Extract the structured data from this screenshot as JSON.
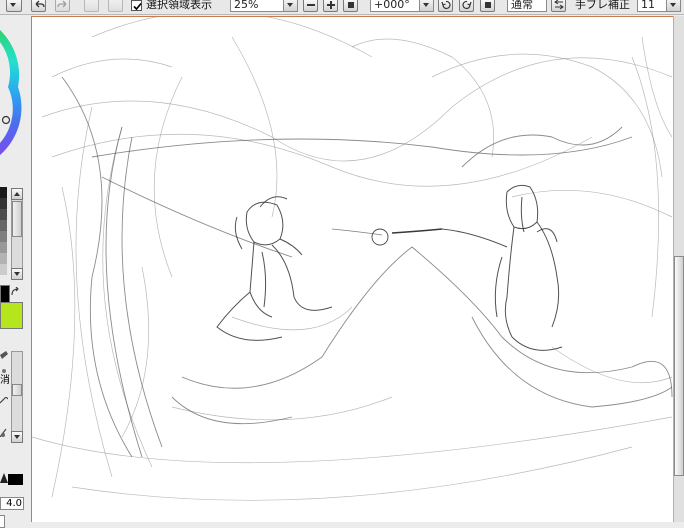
{
  "toolbar": {
    "undo_icon": "undo-icon",
    "redo_icon": "redo-icon",
    "selection_checked": true,
    "selection_label": "選択領域表示",
    "zoom_value": "25%",
    "zoom_buttons": [
      "zoom-out-icon",
      "zoom-in-icon",
      "zoom-reset-icon"
    ],
    "rotation_value": "+000°",
    "rotation_buttons": [
      "rotate-left-icon",
      "rotate-right-icon",
      "rotate-reset-icon"
    ],
    "blend_mode": "通常",
    "flip_icon": "flip-horizontal-icon",
    "stabilizer_label": "手ブレ補正",
    "stabilizer_value": "11"
  },
  "left_panel": {
    "color_wheel_icon": "color-wheel",
    "primary_color": "#000000",
    "secondary_color": "#b5e61d",
    "swap_icon": "swap-colors-icon",
    "tool_label": "消",
    "brush_size": "4.0",
    "shade_swatches": [
      "#1a1a1a",
      "#333333",
      "#4d4d4d",
      "#666666",
      "#808080",
      "#999999",
      "#b3b3b3",
      "#cccccc",
      "#e6e6e6",
      "#ffffff"
    ]
  },
  "canvas": {
    "background": "#ffffff",
    "border_color": "#c97a52"
  }
}
